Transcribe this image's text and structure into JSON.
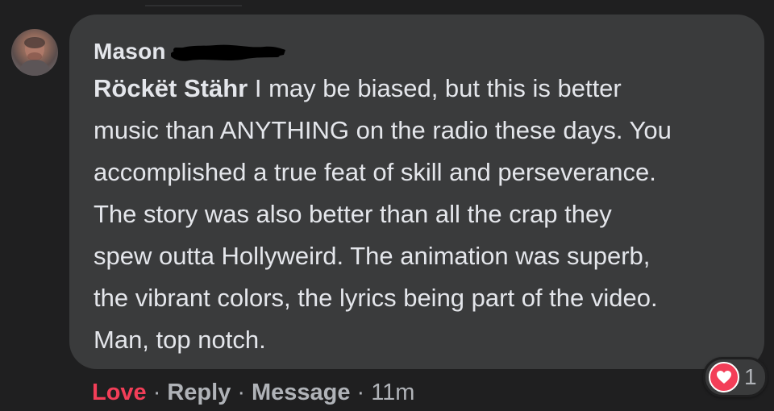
{
  "comment": {
    "author": "Mason",
    "mention": "Röckët Stähr",
    "text_lines": [
      " I may be biased, but this is better",
      "music than ANYTHING on the radio these days. You",
      "accomplished a true feat of skill and perseverance.",
      "The story was also better than all the crap they",
      "spew outta Hollyweird. The animation was superb,",
      "the vibrant colors, the lyrics being part of the video.",
      "Man, top notch."
    ]
  },
  "actions": {
    "love": "Love",
    "reply": "Reply",
    "message": "Message",
    "separator": "·",
    "time": "11m"
  },
  "reactions": {
    "icon": "heart-icon",
    "count": "1"
  },
  "colors": {
    "background": "#1f1f20",
    "bubble": "#3a3b3c",
    "text": "#e4e6eb",
    "muted": "#b0b3b8",
    "love": "#f33e58"
  }
}
